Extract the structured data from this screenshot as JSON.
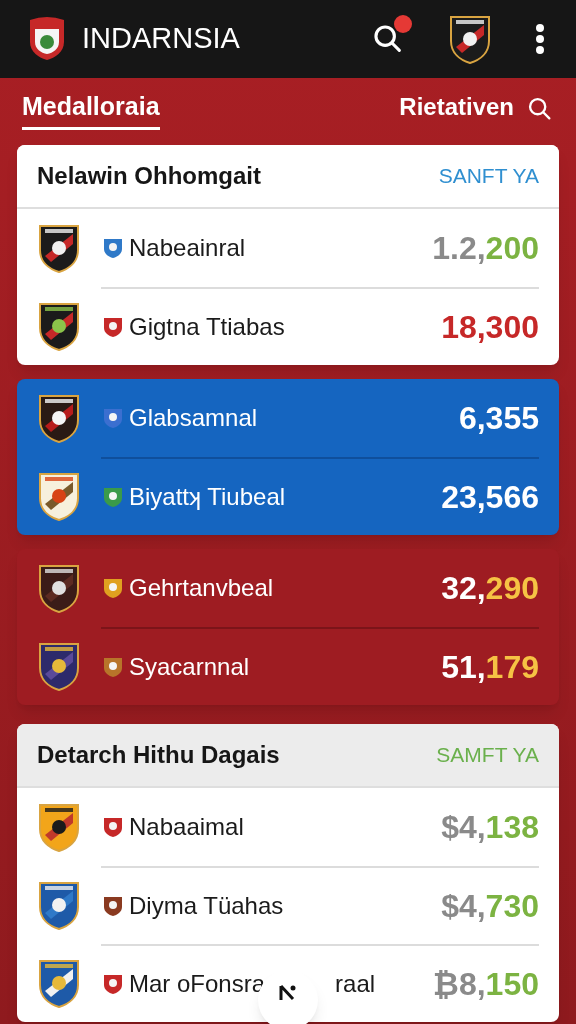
{
  "app_bar": {
    "title": "INDARNSIA",
    "search_badge": true
  },
  "tabs": [
    {
      "label": "Medalloraia",
      "selected": true
    },
    {
      "label": "Rietativen",
      "selected": false
    }
  ],
  "groups": [
    {
      "kind": "light",
      "header": {
        "title": "Nelawin Ohhomgait",
        "action": {
          "label": "SANFT YA",
          "color": "#2f8fd0"
        }
      },
      "rows": [
        {
          "name_parts": [
            "Nabeainral"
          ],
          "value_parts": [
            {
              "text": "1.2,",
              "color": "#8a8a8a"
            },
            {
              "text": "200",
              "color": "#7cb342"
            }
          ]
        },
        {
          "name_parts": [
            "Gigtna Ttiabas"
          ],
          "value_parts": [
            {
              "text": "18,300",
              "color": "#c62828"
            }
          ]
        }
      ]
    },
    {
      "kind": "blue",
      "rows": [
        {
          "name_parts": [
            "Glabsamnal"
          ],
          "value_parts": [
            {
              "text": "6,355",
              "color": "#ffffff"
            }
          ]
        },
        {
          "name_parts": [
            "Biyattʞ Tiubeal"
          ],
          "value_parts": [
            {
              "text": "23,566",
              "color": "#ffffff"
            }
          ]
        }
      ]
    },
    {
      "kind": "red",
      "rows": [
        {
          "name_parts": [
            "Gehrtanvbeal"
          ],
          "value_parts": [
            {
              "text": "32,",
              "color": "#ffffff"
            },
            {
              "text": "290",
              "color": "#f6c244"
            }
          ]
        },
        {
          "name_parts": [
            "Syacarnnal"
          ],
          "value_parts": [
            {
              "text": "51,",
              "color": "#ffffff"
            },
            {
              "text": "179",
              "color": "#f6c244"
            }
          ]
        }
      ]
    },
    {
      "kind": "light",
      "header": {
        "title": "Detarch Hithu Dagais",
        "action": {
          "label": "SAMFT YA",
          "color": "#6ab04c"
        }
      },
      "rows": [
        {
          "name_parts": [
            "Nabaaimal"
          ],
          "value_parts": [
            {
              "text": "$4,",
              "color": "#8a8a8a"
            },
            {
              "text": "138",
              "color": "#7cb342"
            }
          ]
        },
        {
          "name_parts": [
            "Diyma Tüahas"
          ],
          "value_parts": [
            {
              "text": "$4,",
              "color": "#8a8a8a"
            },
            {
              "text": "730",
              "color": "#7cb342"
            }
          ]
        },
        {
          "name_parts": [
            "Mar oFonsra",
            "raal"
          ],
          "value_parts": [
            {
              "text": "₿8,",
              "color": "#8a8a8a"
            },
            {
              "text": "150",
              "color": "#7cb342"
            }
          ]
        }
      ]
    }
  ]
}
